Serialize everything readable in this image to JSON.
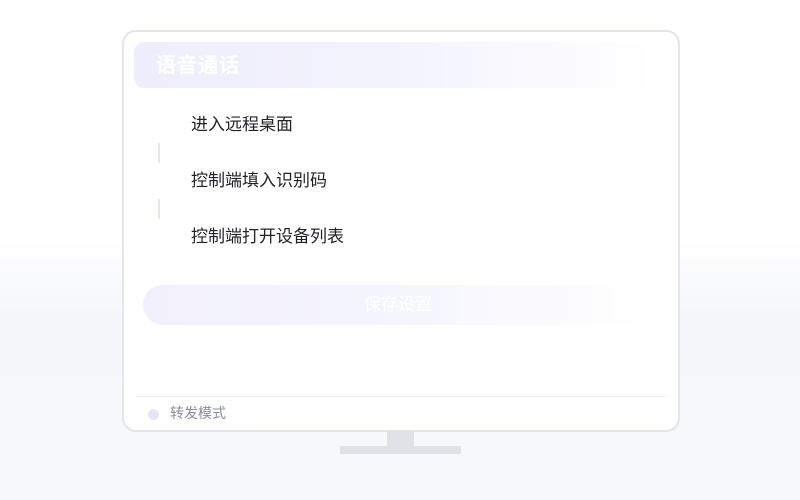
{
  "header": {
    "title": "语音通话"
  },
  "steps": [
    {
      "label": "进入远程桌面"
    },
    {
      "label": "控制端填入识别码"
    },
    {
      "label": "控制端打开设备列表"
    }
  ],
  "actions": {
    "save_label": "保存设置"
  },
  "footer": {
    "mode_label": "转发模式"
  },
  "colors": {
    "accent_light": "#efeefc",
    "text_primary": "#222326",
    "text_muted": "#8a8d94",
    "frame_border": "#e3e5ea"
  }
}
